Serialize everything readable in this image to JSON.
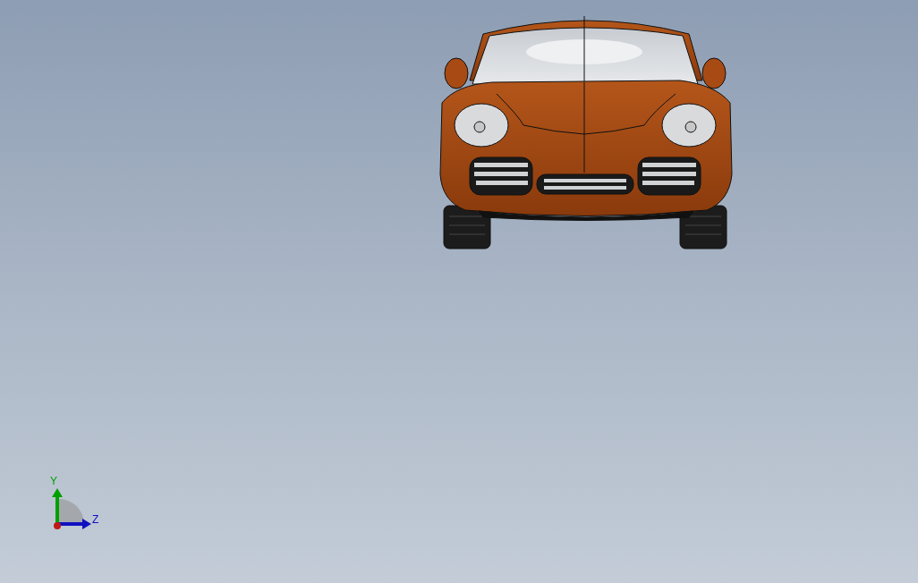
{
  "viewport": {
    "triad": {
      "axes": [
        {
          "label": "Y",
          "color": "#00a000"
        },
        {
          "label": "Z",
          "color": "#1010c0"
        }
      ]
    }
  }
}
